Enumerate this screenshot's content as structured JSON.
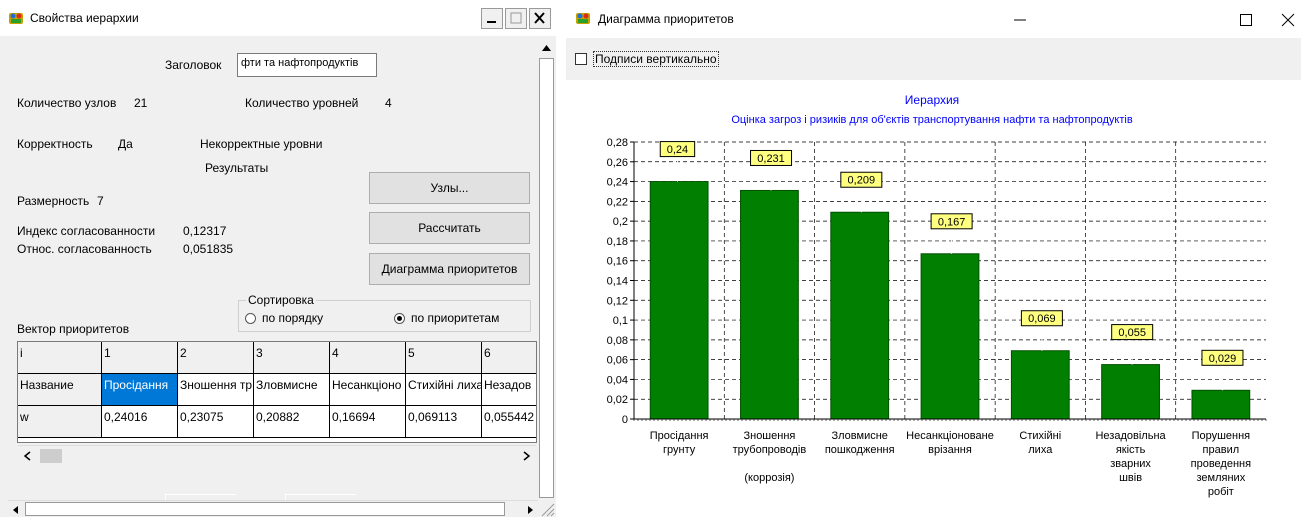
{
  "hierarchy_window": {
    "title": "Свойства иерархии",
    "heading_label": "Заголовок",
    "heading_value": "фти та нафтопродуктів",
    "nodes_label": "Количество узлов",
    "nodes_value": "21",
    "levels_label": "Количество уровней",
    "levels_value": "4",
    "correctness_label": "Корректность",
    "correctness_value": "Да",
    "incorrect_levels_label": "Некорректные уровни",
    "results_label": "Результаты",
    "dimension_label": "Размерность",
    "dimension_value": "7",
    "consistency_index_label": "Индекс согласованности",
    "consistency_index_value": "0,12317",
    "relative_consistency_label": "Относ. согласованность",
    "relative_consistency_value": "0,051835",
    "buttons": {
      "nodes": "Узлы...",
      "calculate": "Рассчитать",
      "priority_chart": "Диаграмма приоритетов"
    },
    "sort": {
      "legend": "Сортировка",
      "by_order": "по порядку",
      "by_priority": "по приоритетам",
      "selected": "by_priority"
    },
    "vector_label": "Вектор приоритетов",
    "grid": {
      "header": [
        "i",
        "1",
        "2",
        "3",
        "4",
        "5",
        "6"
      ],
      "name_row": [
        "Название",
        "Просідання",
        "Зношення тр",
        "Зловмисне",
        "Несанкціоно",
        "Стихійні лиха",
        "Незадов"
      ],
      "w_row": [
        "w",
        "0,24016",
        "0,23075",
        "0,20882",
        "0,16694",
        "0,069113",
        "0,055442"
      ]
    }
  },
  "chart_window": {
    "title": "Диаграмма приоритетов",
    "vertical_labels_checkbox": "Подписи вертикально",
    "vertical_labels_checked": false
  },
  "chart_data": {
    "type": "bar",
    "title": "Иерархия",
    "subtitle": "Оцінка загроз і ризиків для об'єктів транспортування нафти та нафтопродуктів",
    "categories": [
      [
        "Просідання",
        "грунту"
      ],
      [
        "Зношення",
        "трубопроводів",
        "",
        "(коррозія)"
      ],
      [
        "Зловмисне",
        "пошкодження"
      ],
      [
        "Несанкціоноване",
        "врізання"
      ],
      [
        "Стихійні",
        "лиха"
      ],
      [
        "Незадовільна",
        "якість",
        "зварних",
        "швів"
      ],
      [
        "Порушення",
        "правил",
        "проведення",
        "земляних",
        "робіт"
      ]
    ],
    "values": [
      0.24,
      0.231,
      0.209,
      0.167,
      0.069,
      0.055,
      0.029
    ],
    "value_labels": [
      "0,24",
      "0,231",
      "0,209",
      "0,167",
      "0,069",
      "0,055",
      "0,029"
    ],
    "yticks": [
      "0",
      "0,02",
      "0,04",
      "0,06",
      "0,08",
      "0,1",
      "0,12",
      "0,14",
      "0,16",
      "0,18",
      "0,2",
      "0,22",
      "0,24",
      "0,26",
      "0,28"
    ],
    "ylim": [
      0,
      0.28
    ],
    "grid": true,
    "colors": {
      "bar": "#007f00",
      "label_bg": "#ffff80",
      "title": "#0000ff"
    }
  }
}
